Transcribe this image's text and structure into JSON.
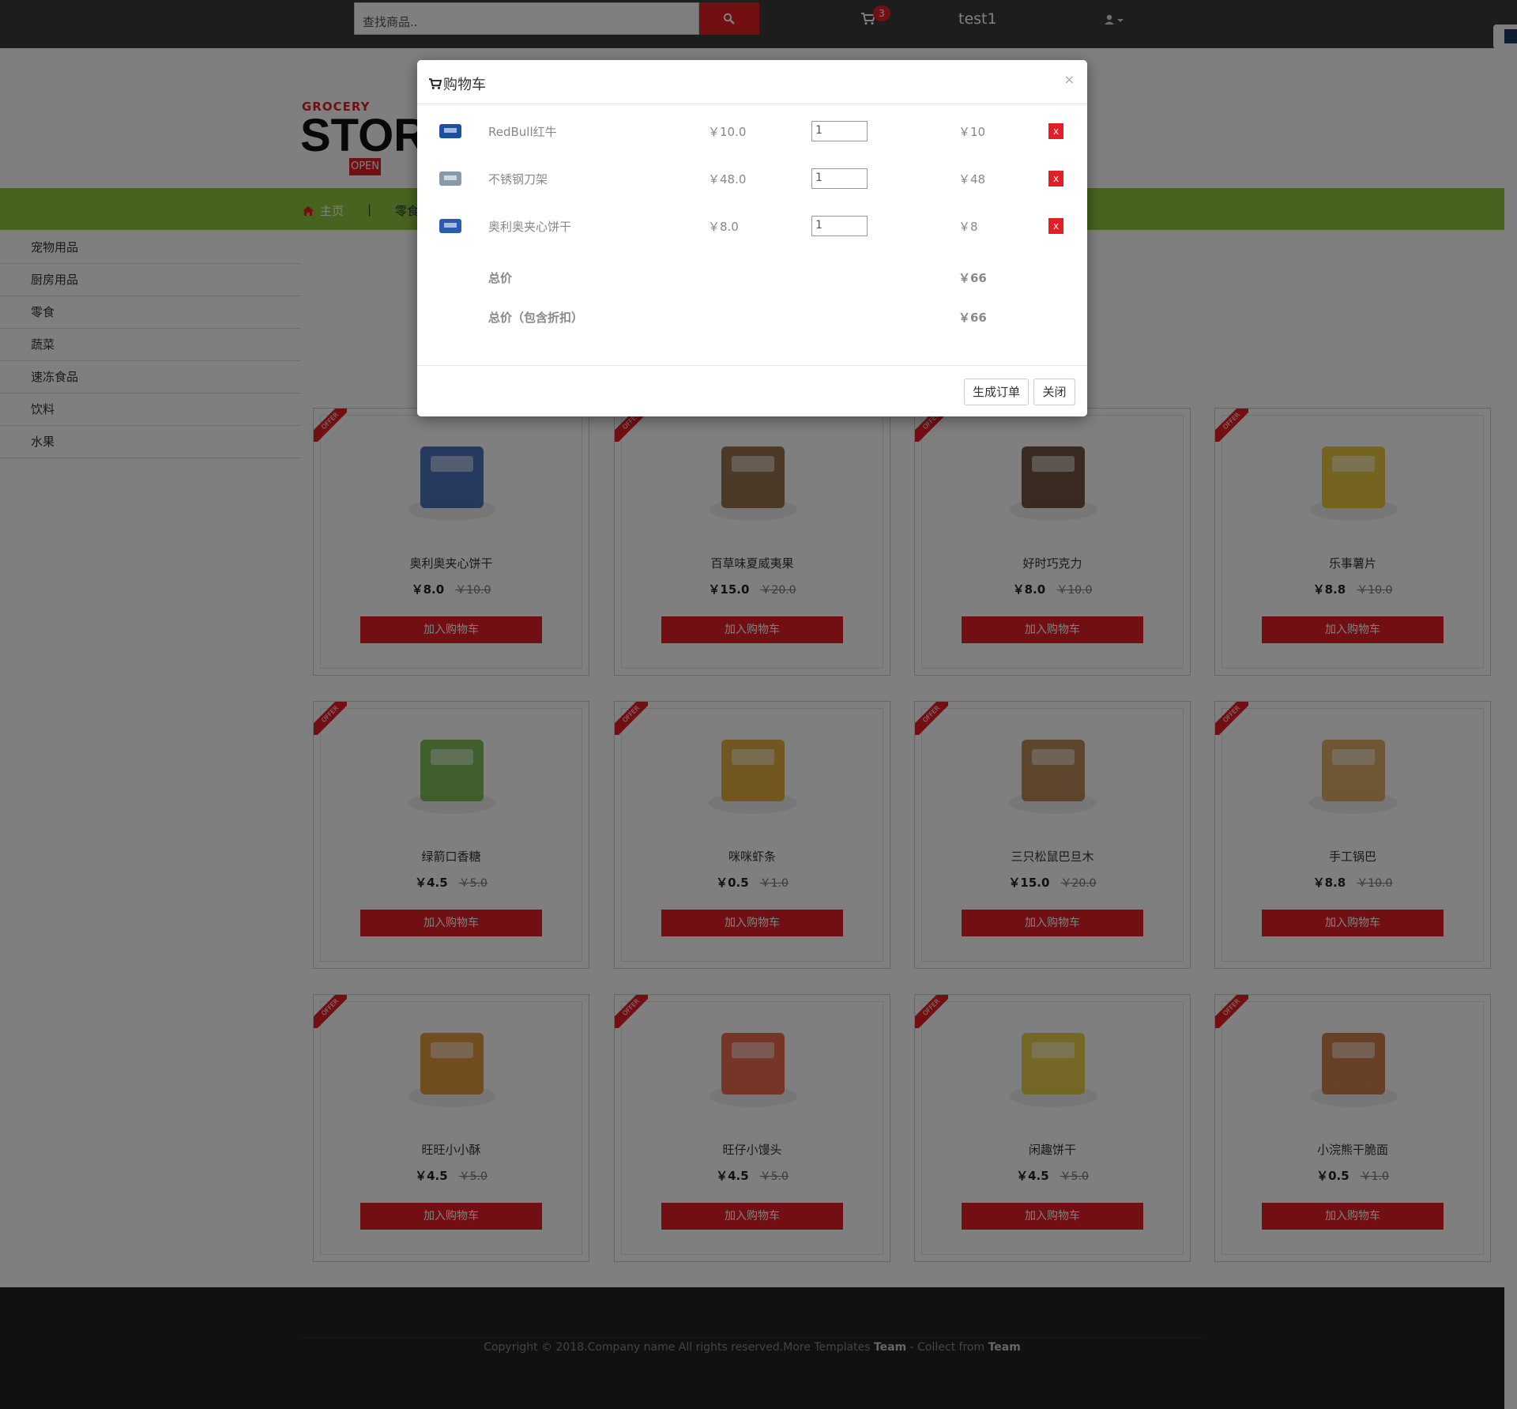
{
  "header": {
    "search_placeholder": "查找商品..",
    "cart_count": "3",
    "username": "test1"
  },
  "logo": {
    "grocery": "GROCERY",
    "store": "STORE",
    "open": "OPEN"
  },
  "nav": {
    "home": "主页",
    "separator": "|",
    "item": "零食"
  },
  "sidebar": {
    "items": [
      {
        "label": "宠物用品"
      },
      {
        "label": "厨房用品"
      },
      {
        "label": "零食"
      },
      {
        "label": "蔬菜"
      },
      {
        "label": "速冻食品"
      },
      {
        "label": "饮料"
      },
      {
        "label": "水果"
      }
    ]
  },
  "offer_label": "OFFER",
  "add_to_cart_label": "加入购物车",
  "products": [
    {
      "name": "奥利奥夹心饼干",
      "price": "￥8.0",
      "old_price": "￥10.0",
      "color": "#2a5db0"
    },
    {
      "name": "百草味夏威夷果",
      "price": "￥15.0",
      "old_price": "￥20.0",
      "color": "#8a5a32"
    },
    {
      "name": "好时巧克力",
      "price": "￥8.0",
      "old_price": "￥10.0",
      "color": "#5a3a22"
    },
    {
      "name": "乐事薯片",
      "price": "￥8.8",
      "old_price": "￥10.0",
      "color": "#e8c020"
    },
    {
      "name": "绿箭口香糖",
      "price": "￥4.5",
      "old_price": "￥5.0",
      "color": "#6db33f"
    },
    {
      "name": "咪咪虾条",
      "price": "￥0.5",
      "old_price": "￥1.0",
      "color": "#e0a020"
    },
    {
      "name": "三只松鼠巴旦木",
      "price": "￥15.0",
      "old_price": "￥20.0",
      "color": "#b07840"
    },
    {
      "name": "手工锅巴",
      "price": "￥8.8",
      "old_price": "￥10.0",
      "color": "#d8a050"
    },
    {
      "name": "旺旺小小酥",
      "price": "￥4.5",
      "old_price": "￥5.0",
      "color": "#e08a20"
    },
    {
      "name": "旺仔小馒头",
      "price": "￥4.5",
      "old_price": "￥5.0",
      "color": "#e85030"
    },
    {
      "name": "闲趣饼干",
      "price": "￥4.5",
      "old_price": "￥5.0",
      "color": "#e8c830"
    },
    {
      "name": "小浣熊干脆面",
      "price": "￥0.5",
      "old_price": "￥1.0",
      "color": "#c86830"
    }
  ],
  "footer": {
    "text_before": "Copyright © 2018.Company name All rights reserved.More Templates ",
    "team1": "Team",
    "text_mid": " - Collect from ",
    "team2": "Team"
  },
  "modal": {
    "title": "购物车",
    "close_x": "×",
    "rows": [
      {
        "name": "RedBull红牛",
        "price": "￥10.0",
        "qty": "1",
        "subtotal": "￥10",
        "delete": "x",
        "color": "#1d4fa0"
      },
      {
        "name": "不锈钢刀架",
        "price": "￥48.0",
        "qty": "1",
        "subtotal": "￥48",
        "delete": "x",
        "color": "#8899aa"
      },
      {
        "name": "奥利奥夹心饼干",
        "price": "￥8.0",
        "qty": "1",
        "subtotal": "￥8",
        "delete": "x",
        "color": "#2a5db0"
      }
    ],
    "total_label": "总价",
    "total_value": "￥66",
    "discount_label": "总价（包含折扣）",
    "discount_value": "￥66",
    "submit_label": "生成订单",
    "close_label": "关闭"
  },
  "colors": {
    "accent": "#e21f26",
    "nav_green": "#8dc63f",
    "topbar": "#3b3b3b",
    "footer": "#222222"
  }
}
